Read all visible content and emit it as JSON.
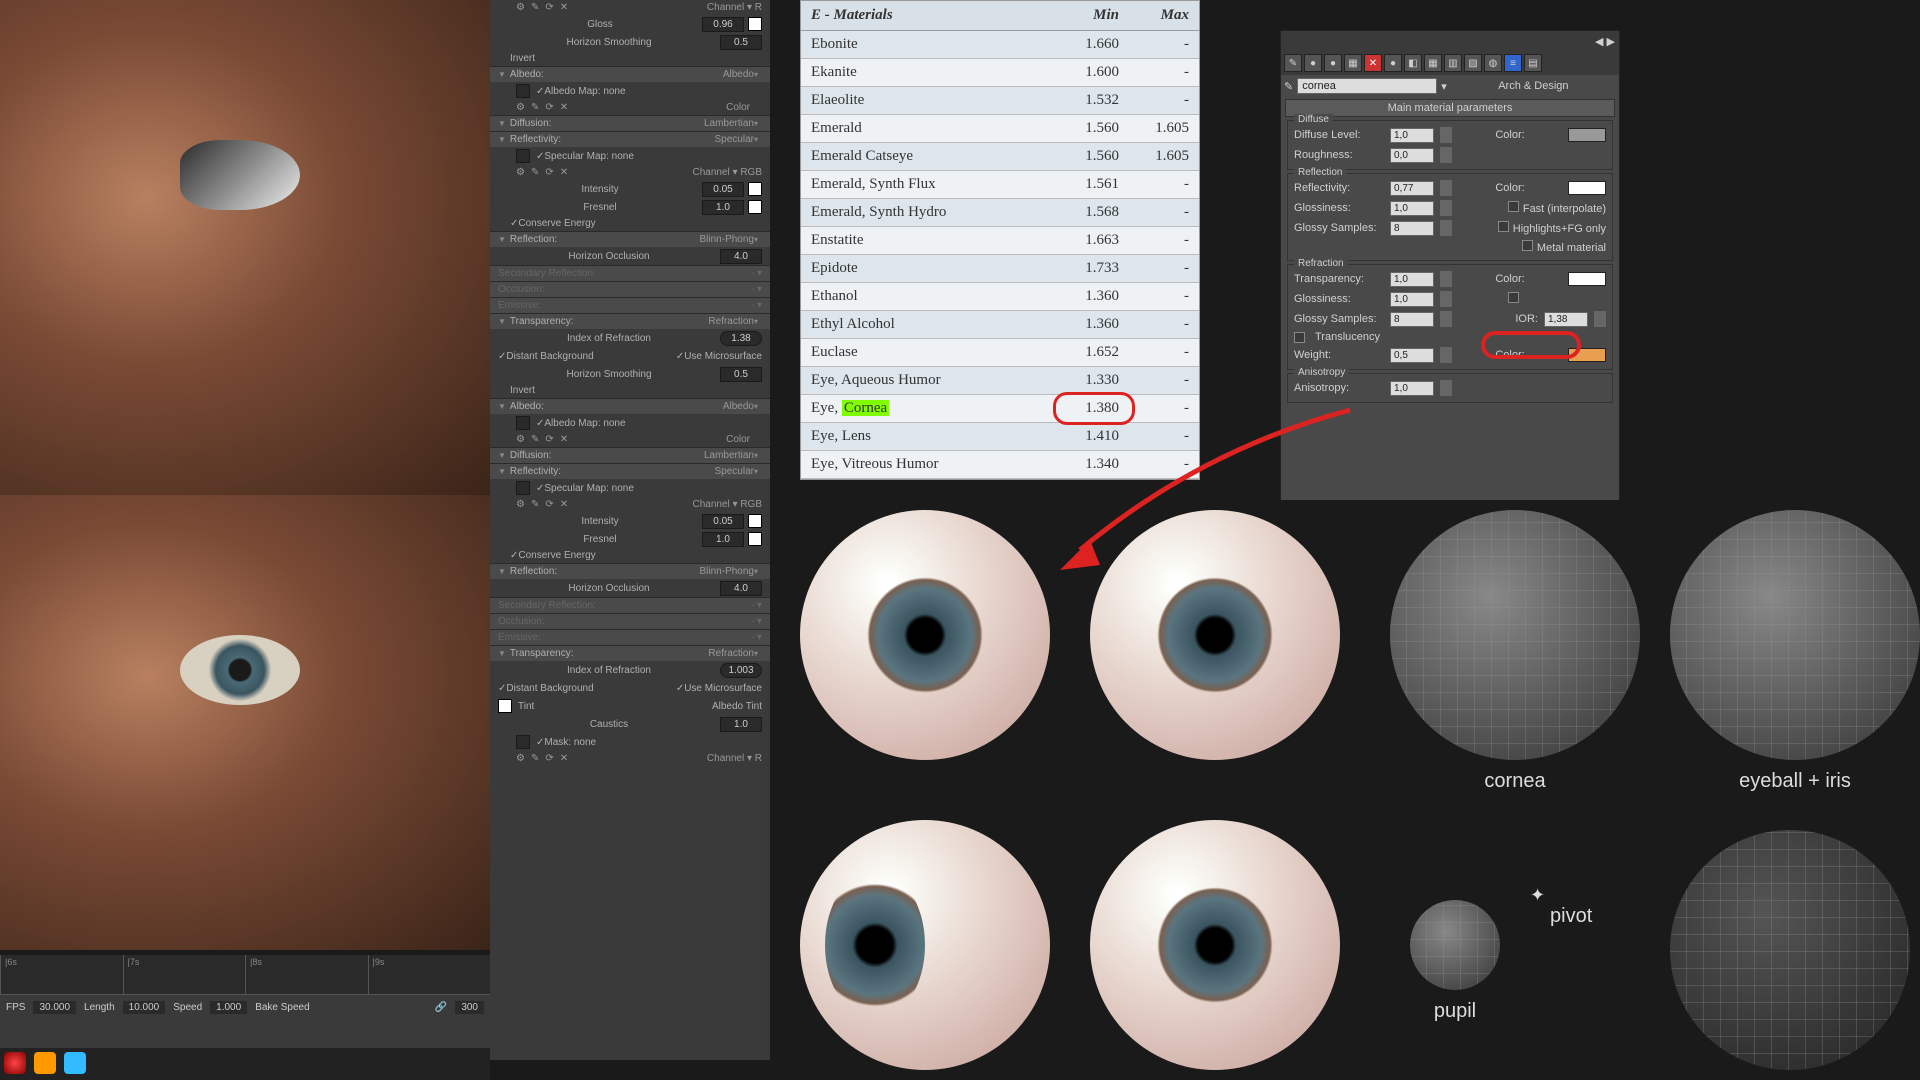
{
  "timeline": {
    "ticks": [
      "|6s",
      "|7s",
      "|8s",
      "|9s"
    ],
    "fps_label": "FPS",
    "fps": "30.000",
    "len_label": "Length",
    "len": "10.000",
    "spd_label": "Speed",
    "spd": "1.000",
    "bake": "Bake Speed",
    "deg": "300"
  },
  "props": {
    "channel": "Channel",
    "rgb": "RGB",
    "r": "R",
    "gloss": "Gloss",
    "gloss_v": "0.96",
    "hsmooth": "Horizon Smoothing",
    "hsmooth_v": "0.5",
    "invert": "Invert",
    "albedo": "Albedo:",
    "albedo_m": "Albedo",
    "albedo_map": "✓Albedo Map:",
    "none": "none",
    "color": "Color",
    "diffusion": "Diffusion:",
    "lambertian": "Lambertian",
    "reflectivity": "Reflectivity:",
    "specular": "Specular",
    "spec_map": "✓Specular Map:",
    "intensity": "Intensity",
    "intensity_v": "0.05",
    "fresnel": "Fresnel",
    "fresnel_v": "1.0",
    "conserve": "✓Conserve Energy",
    "reflection": "Reflection:",
    "blinn": "Blinn-Phong",
    "horiz_occ": "Horizon Occlusion",
    "horiz_occ_v": "4.0",
    "sec_refl": "Secondary Reflection:",
    "occlusion": "Occlusion:",
    "emissive": "Emissive:",
    "transparency": "Transparency:",
    "refraction": "Refraction",
    "ior": "Index of Refraction",
    "ior_v1": "1.38",
    "ior_v2": "1.003",
    "distant": "✓Distant Background",
    "usems": "✓Use Microsurface",
    "tint": "Tint",
    "albedo_tint": "Albedo Tint",
    "caustics": "Caustics",
    "caustics_v": "1.0",
    "mask": "✓Mask:"
  },
  "table": {
    "h1": "E - Materials",
    "h2": "Min",
    "h3": "Max",
    "rows": [
      {
        "n": "Ebonite",
        "min": "1.660",
        "max": "-"
      },
      {
        "n": "Ekanite",
        "min": "1.600",
        "max": "-"
      },
      {
        "n": "Elaeolite",
        "min": "1.532",
        "max": "-"
      },
      {
        "n": "Emerald",
        "min": "1.560",
        "max": "1.605"
      },
      {
        "n": "Emerald Catseye",
        "min": "1.560",
        "max": "1.605"
      },
      {
        "n": "Emerald, Synth Flux",
        "min": "1.561",
        "max": "-"
      },
      {
        "n": "Emerald, Synth Hydro",
        "min": "1.568",
        "max": "-"
      },
      {
        "n": "Enstatite",
        "min": "1.663",
        "max": "-"
      },
      {
        "n": "Epidote",
        "min": "1.733",
        "max": "-"
      },
      {
        "n": "Ethanol",
        "min": "1.360",
        "max": "-"
      },
      {
        "n": "Ethyl Alcohol",
        "min": "1.360",
        "max": "-"
      },
      {
        "n": "Euclase",
        "min": "1.652",
        "max": "-"
      },
      {
        "n": "Eye, Aqueous Humor",
        "min": "1.330",
        "max": "-"
      },
      {
        "n": "Eye, ",
        "hi": "Cornea",
        "min": "1.380",
        "max": "-",
        "circle": true
      },
      {
        "n": "Eye, Lens",
        "min": "1.410",
        "max": "-"
      },
      {
        "n": "Eye, Vitreous Humor",
        "min": "1.340",
        "max": "-"
      }
    ]
  },
  "max": {
    "matname": "cornea",
    "mattype": "Arch & Design",
    "rollup": "Main material parameters",
    "diffuse": "Diffuse",
    "diff_lvl": "Diffuse Level:",
    "diff_lvl_v": "1,0",
    "rough": "Roughness:",
    "rough_v": "0,0",
    "color": "Color:",
    "reflection": "Reflection",
    "refl": "Reflectivity:",
    "refl_v": "0,77",
    "gloss": "Glossiness:",
    "gloss_v": "1,0",
    "gsamp": "Glossy Samples:",
    "gsamp_v": "8",
    "fast": "Fast (interpolate)",
    "hifi": "Highlights+FG only",
    "metal": "Metal material",
    "refraction": "Refraction",
    "trans": "Transparency:",
    "trans_v": "1,0",
    "ior": "IOR:",
    "ior_v": "1,38",
    "transluc": "Translucency",
    "weight": "Weight:",
    "weight_v": "0,5",
    "aniso": "Anisotropy",
    "aniso_l": "Anisotropy:",
    "aniso_v": "1,0"
  },
  "labels": {
    "cornea": "cornea",
    "eyeball": "eyeball + iris",
    "pupil": "pupil",
    "pivot": "pivot"
  }
}
